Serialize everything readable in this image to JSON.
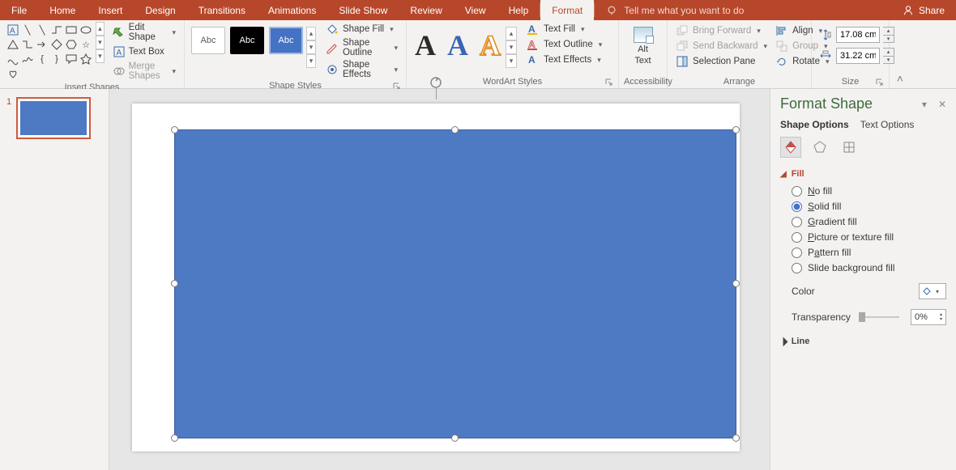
{
  "menu": {
    "tabs": [
      "File",
      "Home",
      "Insert",
      "Design",
      "Transitions",
      "Animations",
      "Slide Show",
      "Review",
      "View",
      "Help",
      "Format"
    ],
    "active": "Format",
    "tell": "Tell me what you want to do",
    "share": "Share"
  },
  "ribbon": {
    "insert_shapes": {
      "label": "Insert Shapes",
      "edit_shape": "Edit Shape",
      "text_box": "Text Box",
      "merge_shapes": "Merge Shapes"
    },
    "shape_styles": {
      "label": "Shape Styles",
      "swatch_text": "Abc",
      "shape_fill": "Shape Fill",
      "shape_outline": "Shape Outline",
      "shape_effects": "Shape Effects"
    },
    "wordart": {
      "label": "WordArt Styles",
      "text_fill": "Text Fill",
      "text_outline": "Text Outline",
      "text_effects": "Text Effects"
    },
    "accessibility": {
      "label": "Accessibility",
      "alt_text_top": "Alt",
      "alt_text_bottom": "Text"
    },
    "arrange": {
      "label": "Arrange",
      "bring_forward": "Bring Forward",
      "send_backward": "Send Backward",
      "selection_pane": "Selection Pane",
      "align": "Align",
      "group": "Group",
      "rotate": "Rotate"
    },
    "size": {
      "label": "Size",
      "height": "17.08 cm",
      "width": "31.22 cm"
    }
  },
  "thumb": {
    "index": "1"
  },
  "pane": {
    "title": "Format Shape",
    "tab_shape": "Shape Options",
    "tab_text": "Text Options",
    "fill": {
      "title": "Fill",
      "no_fill": [
        "N",
        "o fill"
      ],
      "solid_fill": [
        "S",
        "olid fill"
      ],
      "gradient_fill": [
        "G",
        "radient fill"
      ],
      "picture_fill": [
        "P",
        "icture or texture fill"
      ],
      "pattern_fill": [
        "P",
        "a",
        "ttern fill"
      ],
      "slide_bg": "Slide background fill",
      "selected": "solid",
      "color_label": [
        "C",
        "olor"
      ],
      "transparency_label": [
        "T",
        "ransparency"
      ],
      "transparency_val": "0%"
    },
    "line": {
      "title": "Line"
    }
  }
}
